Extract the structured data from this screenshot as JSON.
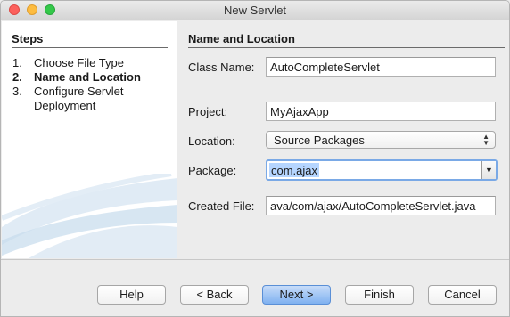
{
  "window": {
    "title": "New Servlet"
  },
  "steps": {
    "heading": "Steps",
    "items": [
      {
        "num": "1.",
        "label": "Choose File Type"
      },
      {
        "num": "2.",
        "label": "Name and Location"
      },
      {
        "num": "3.",
        "label": "Configure Servlet Deployment"
      }
    ],
    "active_index": 1
  },
  "form": {
    "heading": "Name and Location",
    "class_name_label": "Class Name:",
    "class_name_value": "AutoCompleteServlet",
    "project_label": "Project:",
    "project_value": "MyAjaxApp",
    "location_label": "Location:",
    "location_value": "Source Packages",
    "package_label": "Package:",
    "package_value": "com.ajax",
    "created_file_label": "Created File:",
    "created_file_value": "ava/com/ajax/AutoCompleteServlet.java"
  },
  "buttons": {
    "help": "Help",
    "back": "< Back",
    "next": "Next >",
    "finish": "Finish",
    "cancel": "Cancel"
  },
  "colors": {
    "accent": "#7aa9e6",
    "selection": "#b5d5ff"
  }
}
